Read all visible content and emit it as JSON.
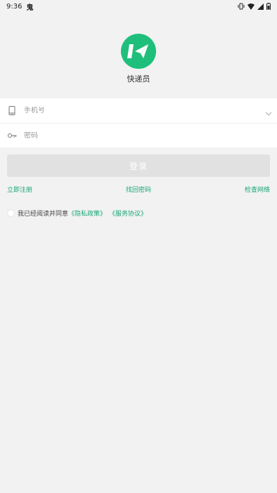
{
  "status_bar": {
    "time": "9:36",
    "carrier_glyph": "鬼"
  },
  "app": {
    "name": "快递员",
    "logo_color": "#1fbf7b"
  },
  "form": {
    "phone_placeholder": "手机号",
    "password_placeholder": "密码",
    "login_label": "登录"
  },
  "links": {
    "register": "立即注册",
    "recover": "找回密码",
    "check_network": "检查网络"
  },
  "agreement": {
    "prefix": "我已经阅读并同意",
    "privacy": "《隐私政策》",
    "service": "《服务协议》"
  },
  "colors": {
    "accent": "#1aa876",
    "button_disabled": "#e1e1e1",
    "background": "#f2f2f2"
  }
}
